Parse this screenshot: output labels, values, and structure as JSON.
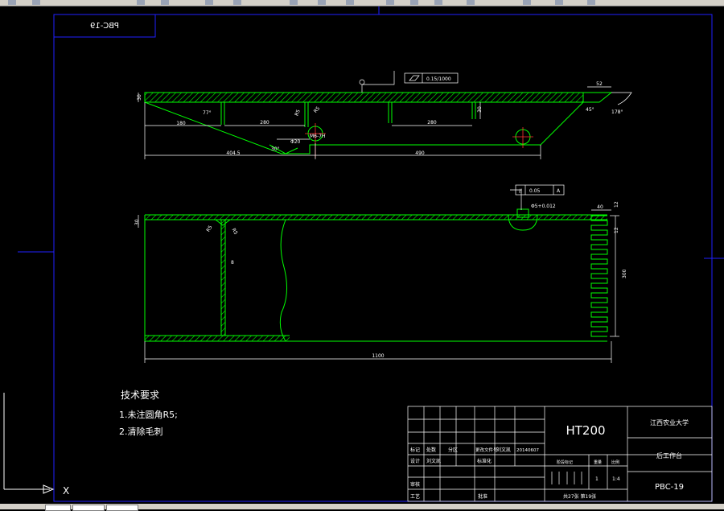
{
  "drawing": {
    "part_code": "PBC-19",
    "part_code_mirrored": "PBC-19",
    "material": "HT200",
    "school": "江西农业大学",
    "drawing_title": "后工作台",
    "sheet_info": "共27张  第19张",
    "scale": "1:4",
    "quantity": "1",
    "title_block": {
      "r1c1": "标记",
      "r1c2": "处数",
      "r1c3": "分区",
      "r1c4": "更改文件号",
      "r1c5": "刘文凯",
      "r1c6": "20140607",
      "r2c1": "设计",
      "r2c2": "刘文凯",
      "r2c3": "标准化",
      "r3c1": "审核",
      "r4c1": "工艺",
      "r4c3": "批准",
      "h_stage": "阶段标记",
      "h_weight": "重量",
      "h_scale": "比例"
    },
    "notes_title": "技术要求",
    "notes": [
      "1.未注圆角R5;",
      "2.清除毛刺"
    ],
    "top_view": {
      "flatness": "0.15/1000",
      "dim_left": "180",
      "dim_mid1": "280",
      "dim_mid2": "280",
      "dim_total_left": "404.5",
      "dim_total_right": "490",
      "dim_thickness": "30",
      "dim_right_thk": "30",
      "angle_top": "77°",
      "angle_bottom": "30°",
      "angle_right": "45°",
      "angle_tip": "178°",
      "dim_tip": "52",
      "hole_label": "M6-7H",
      "dia_label": "Φ20",
      "radius": "R5"
    },
    "bottom_view": {
      "parallel": "0.05",
      "datum": "A",
      "hole_dia": "Φ5+0.012",
      "dim_thk": "30",
      "web": "8",
      "r_left": "R5",
      "r_right": "R5",
      "teeth_w": "40",
      "teeth_pitch": "12",
      "teeth_gap": "12",
      "teeth_h": "300",
      "length": "1100"
    }
  },
  "ucs": {
    "x_label": "X"
  }
}
